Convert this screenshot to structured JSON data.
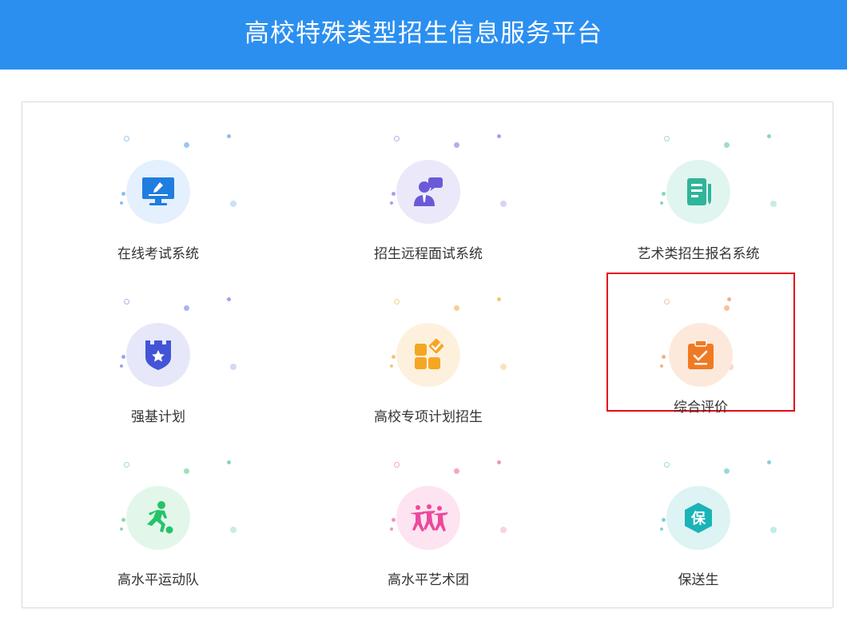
{
  "header": {
    "title": "高校特殊类型招生信息服务平台"
  },
  "tiles": [
    {
      "label": "在线考试系统",
      "icon": "monitor-pen-icon",
      "color": "#1f7de0",
      "bg": "#e4f0fd"
    },
    {
      "label": "招生远程面试系统",
      "icon": "interviewer-icon",
      "color": "#6a5ad8",
      "bg": "#ebe8f9"
    },
    {
      "label": "艺术类招生报名系统",
      "icon": "document-pen-icon",
      "color": "#2fb59a",
      "bg": "#e1f5f0"
    },
    {
      "label": "强基计划",
      "icon": "castle-shield-icon",
      "color": "#4355d6",
      "bg": "#e6e8fa"
    },
    {
      "label": "高校专项计划招生",
      "icon": "apps-check-icon",
      "color": "#f5a623",
      "bg": "#fdf1de"
    },
    {
      "label": "综合评价",
      "icon": "clipboard-check-icon",
      "color": "#f07a24",
      "bg": "#fde9dc",
      "selected": true
    },
    {
      "label": "高水平运动队",
      "icon": "soccer-player-icon",
      "color": "#25c36a",
      "bg": "#e2f7ea"
    },
    {
      "label": "高水平艺术团",
      "icon": "dancers-icon",
      "color": "#ec4a9c",
      "bg": "#fde4f0"
    },
    {
      "label": "保送生",
      "icon": "badge-bao-icon",
      "color": "#19b3b8",
      "bg": "#ddf3f4",
      "glyph": "保"
    }
  ]
}
